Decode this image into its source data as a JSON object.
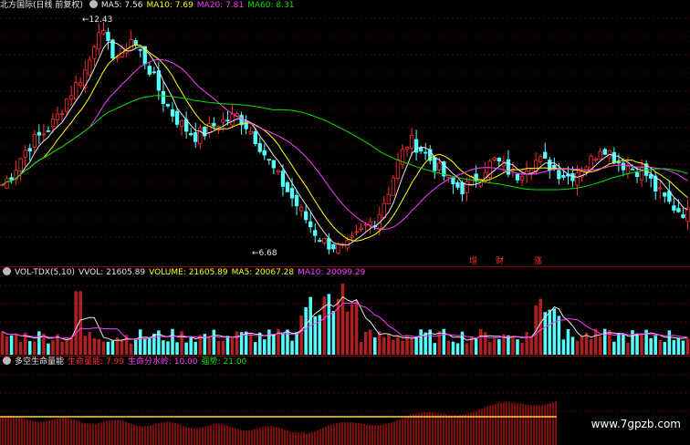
{
  "price_header": {
    "stock_label": "北方国际(日线 前复权)",
    "ma5": "MA5: 7.56",
    "ma10": "MA10: 7.69",
    "ma20": "MA20: 7.81",
    "ma60": "MA60: 8.31"
  },
  "price_annotations": {
    "high": "12.43",
    "low": "6.68"
  },
  "event_marks": [
    "增",
    "财",
    "涨"
  ],
  "volume_header": {
    "indicator": "VOL-TDX(5,10)",
    "vvol": "VVOL: 21605.89",
    "volume": "VOLUME: 21605.89",
    "ma5": "MA5: 20067.28",
    "ma10": "MA10: 20099.29"
  },
  "indicator_header": {
    "name": "多空生命量能",
    "life_energy": "生命量能: 7.99",
    "life_water": "生命分水岭: 10.00",
    "strong": "强势: 21.00"
  },
  "watermark": "www.7gpzb.com",
  "colors": {
    "up": "#ff3030",
    "down": "#54ffff",
    "ma5": "#e8e8e8",
    "ma10": "#ffff00",
    "ma20": "#ff3cff",
    "ma60": "#00e000",
    "grid": "#7a0000",
    "ind_line": "#ffd24a"
  },
  "chart_data": {
    "type": "candlestick",
    "price_max": 12.43,
    "price_min": 6.68,
    "close_approx": [
      8.3,
      8.6,
      9.1,
      9.4,
      9.6,
      9.9,
      10.4,
      10.8,
      11.2,
      12.2,
      11.6,
      11.4,
      11.9,
      11.5,
      11.0,
      10.4,
      10.0,
      9.7,
      9.5,
      9.6,
      9.8,
      9.9,
      10.0,
      9.7,
      9.3,
      8.8,
      8.4,
      8.0,
      7.6,
      7.2,
      6.9,
      6.8,
      6.7,
      7.0,
      7.3,
      7.5,
      8.1,
      8.9,
      9.4,
      9.2,
      8.9,
      8.6,
      8.3,
      8.2,
      8.4,
      8.7,
      8.9,
      8.7,
      8.5,
      8.8,
      8.9,
      8.8,
      8.6,
      8.5,
      8.7,
      8.9,
      9.3,
      9.0,
      8.8,
      8.7,
      8.6,
      8.2,
      7.9,
      7.7,
      7.6
    ]
  }
}
